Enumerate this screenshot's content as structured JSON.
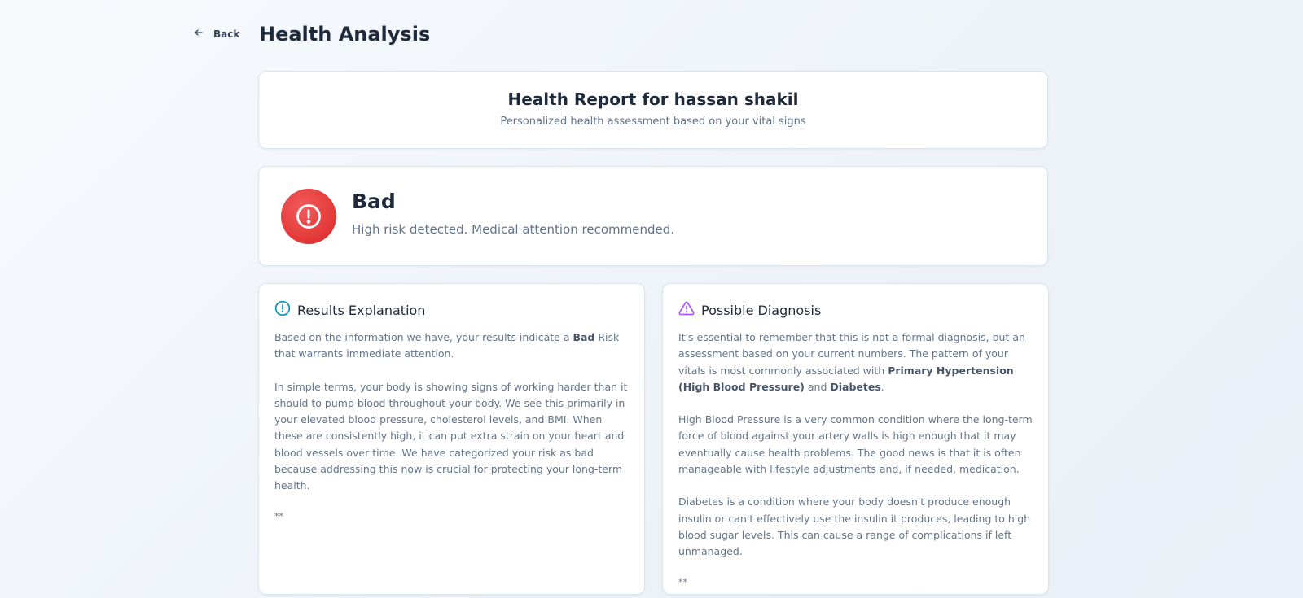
{
  "nav": {
    "back_label": "Back"
  },
  "page": {
    "title": "Health Analysis"
  },
  "report": {
    "title": "Health Report for hassan shakil",
    "subtitle": "Personalized health assessment based on your vital signs"
  },
  "status": {
    "label": "Bad",
    "description": "High risk detected. Medical attention recommended.",
    "color": "#dc2626"
  },
  "results": {
    "title": "Results Explanation",
    "p1_pre": "Based on the information we have, your results indicate a ",
    "p1_bold": "Bad",
    "p1_post": " Risk that warrants immediate attention.",
    "p2": "In simple terms, your body is showing signs of working harder than it should to pump blood throughout your body. We see this primarily in your elevated blood pressure, cholesterol levels, and BMI. When these are consistently high, it can put extra strain on your heart and blood vessels over time. We have categorized your risk as bad because addressing this now is crucial for protecting your long-term health.",
    "footer": "**"
  },
  "diagnosis": {
    "title": "Possible Diagnosis",
    "p1_pre": "It's essential to remember that this is not a formal diagnosis, but an assessment based on your current numbers. The pattern of your vitals is most commonly associated with ",
    "p1_bold1": "Primary Hypertension (High Blood Pressure)",
    "p1_mid": " and ",
    "p1_bold2": "Diabetes",
    "p1_post": ".",
    "p2": "High Blood Pressure is a very common condition where the long-term force of blood against your artery walls is high enough that it may eventually cause health problems. The good news is that it is often manageable with lifestyle adjustments and, if needed, medication.",
    "p3": "Diabetes is a condition where your body doesn't produce enough insulin or can't effectively use the insulin it produces, leading to high blood sugar levels. This can cause a range of complications if left unmanaged.",
    "footer": "**"
  },
  "icons": {
    "back": "arrow-left-icon",
    "status": "alert-circle-icon",
    "results": "info-circle-icon",
    "diagnosis": "warning-triangle-icon"
  },
  "colors": {
    "info_icon": "#0891b2",
    "diagnosis_icon": "#a855f7"
  }
}
